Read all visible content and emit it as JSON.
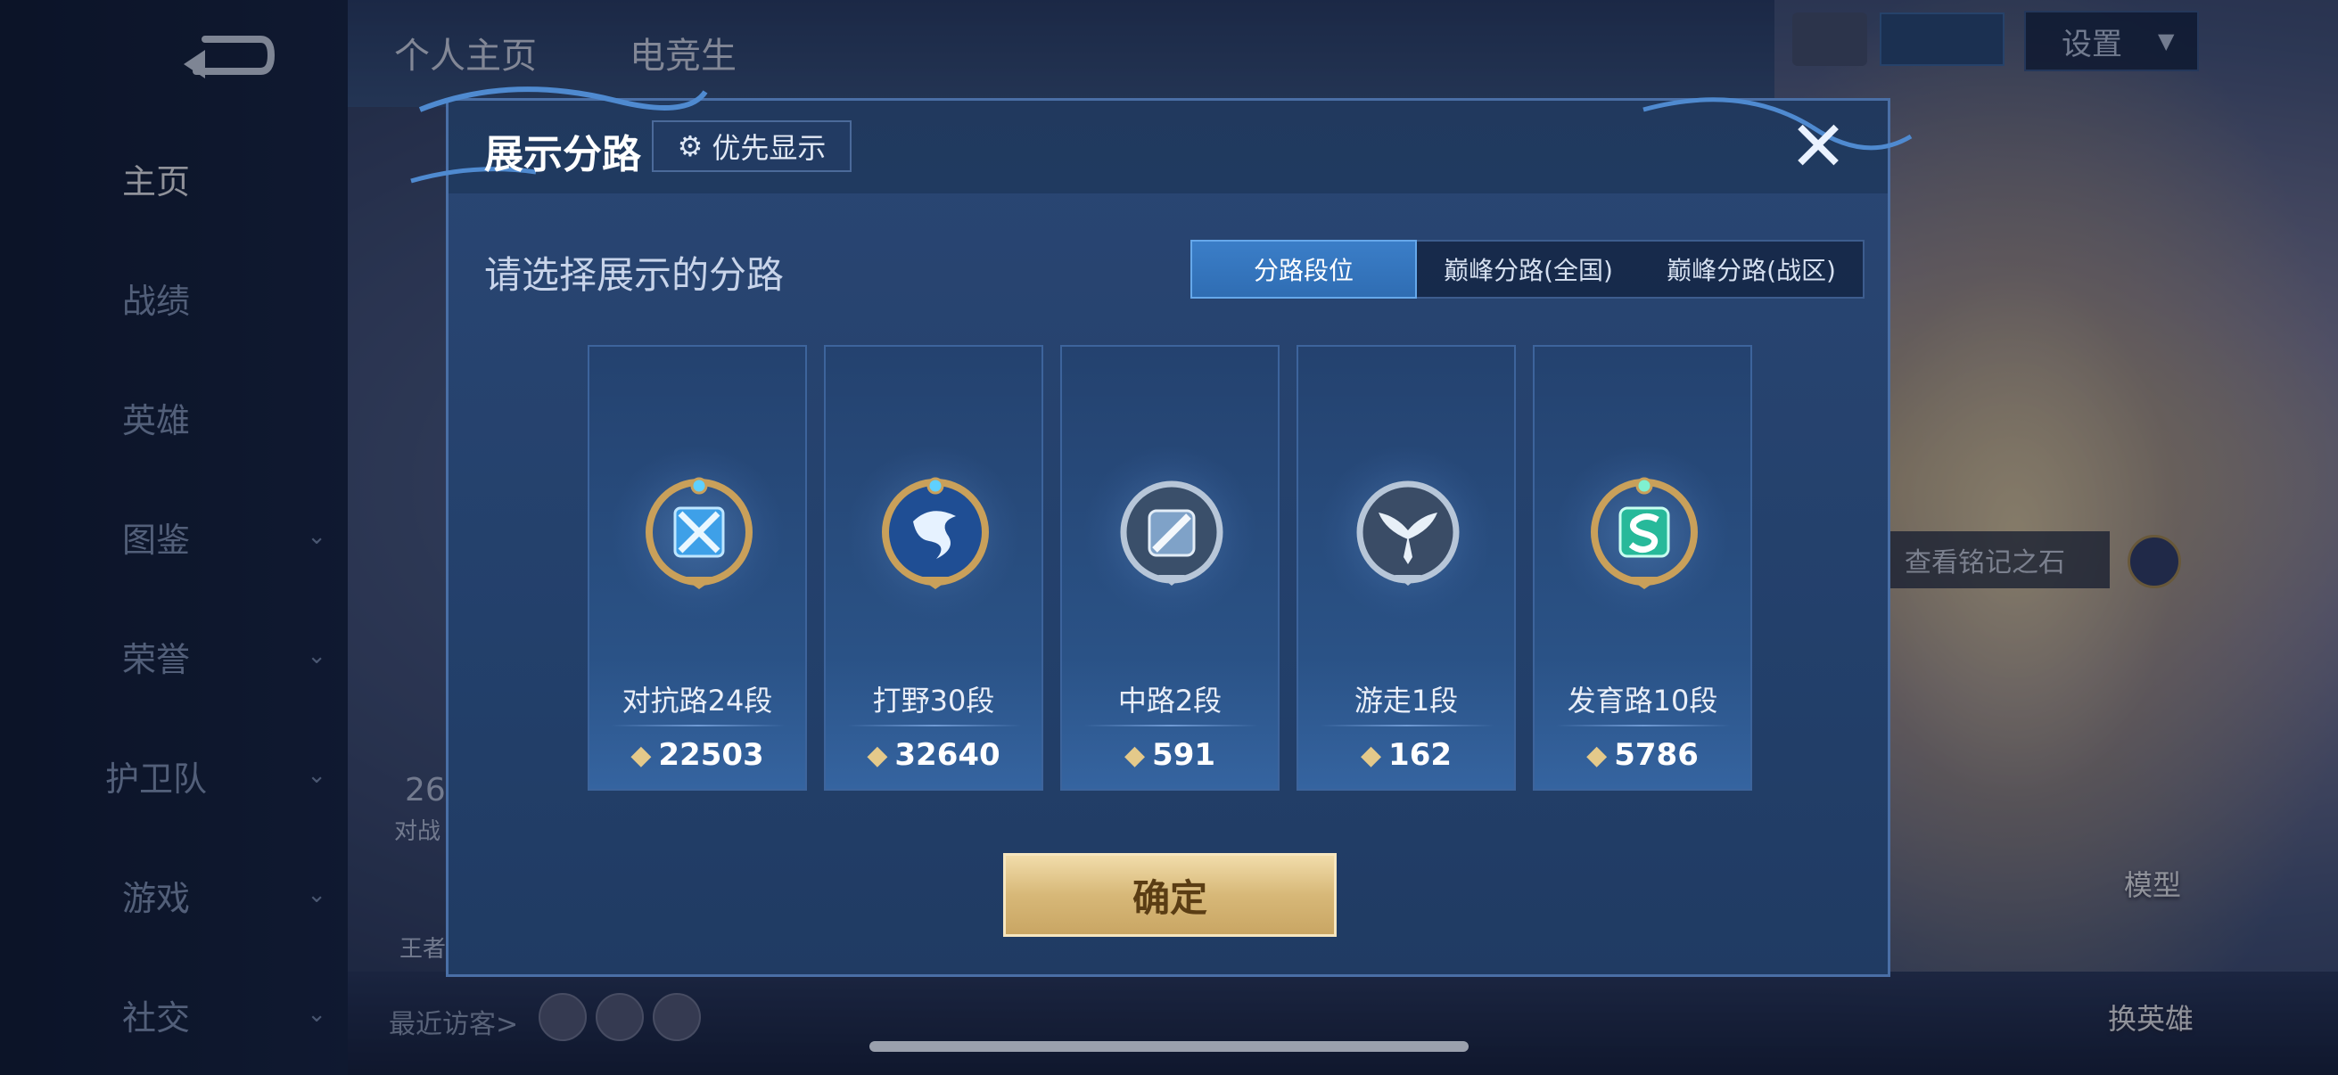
{
  "background": {
    "top_tabs": [
      "个人主页",
      "电竞生"
    ],
    "settings_label": "设置",
    "status_text": "",
    "side_numbers": {
      "count": "26",
      "count_label": "对战"
    },
    "honor_label": "王者",
    "visitors_label": "最近访客>",
    "rune_stone_text": "查看铭记之石",
    "model_label": "模型",
    "change_hero_label": "换英雄"
  },
  "sidebar": {
    "items": [
      {
        "label": "主页",
        "active": true,
        "chevron": false
      },
      {
        "label": "战绩",
        "active": false,
        "chevron": false
      },
      {
        "label": "英雄",
        "active": false,
        "chevron": false
      },
      {
        "label": "图鉴",
        "active": false,
        "chevron": true
      },
      {
        "label": "荣誉",
        "active": false,
        "chevron": true
      },
      {
        "label": "护卫队",
        "active": false,
        "chevron": true
      },
      {
        "label": "游戏",
        "active": false,
        "chevron": true
      },
      {
        "label": "社交",
        "active": false,
        "chevron": true
      }
    ]
  },
  "modal": {
    "title": "展示分路",
    "priority_label": "优先显示",
    "close_glyph": "✕",
    "prompt": "请选择展示的分路",
    "segments": [
      {
        "label": "分路段位",
        "active": true
      },
      {
        "label": "巅峰分路(全国)",
        "active": false
      },
      {
        "label": "巅峰分路(战区)",
        "active": false
      }
    ],
    "lanes": [
      {
        "rank": "对抗路24段",
        "score": "22503",
        "icon": "clash-lane-badge-icon",
        "color": "#3ea0e8"
      },
      {
        "rank": "打野30段",
        "score": "32640",
        "icon": "jungle-dragon-badge-icon",
        "color": "#2d68b8"
      },
      {
        "rank": "中路2段",
        "score": "591",
        "icon": "mid-lane-badge-icon",
        "color": "#7fa2c8"
      },
      {
        "rank": "游走1段",
        "score": "162",
        "icon": "roam-wings-badge-icon",
        "color": "#8aa3c4"
      },
      {
        "rank": "发育路10段",
        "score": "5786",
        "icon": "farm-lane-badge-icon",
        "color": "#27b99a"
      }
    ],
    "confirm_label": "确定"
  }
}
